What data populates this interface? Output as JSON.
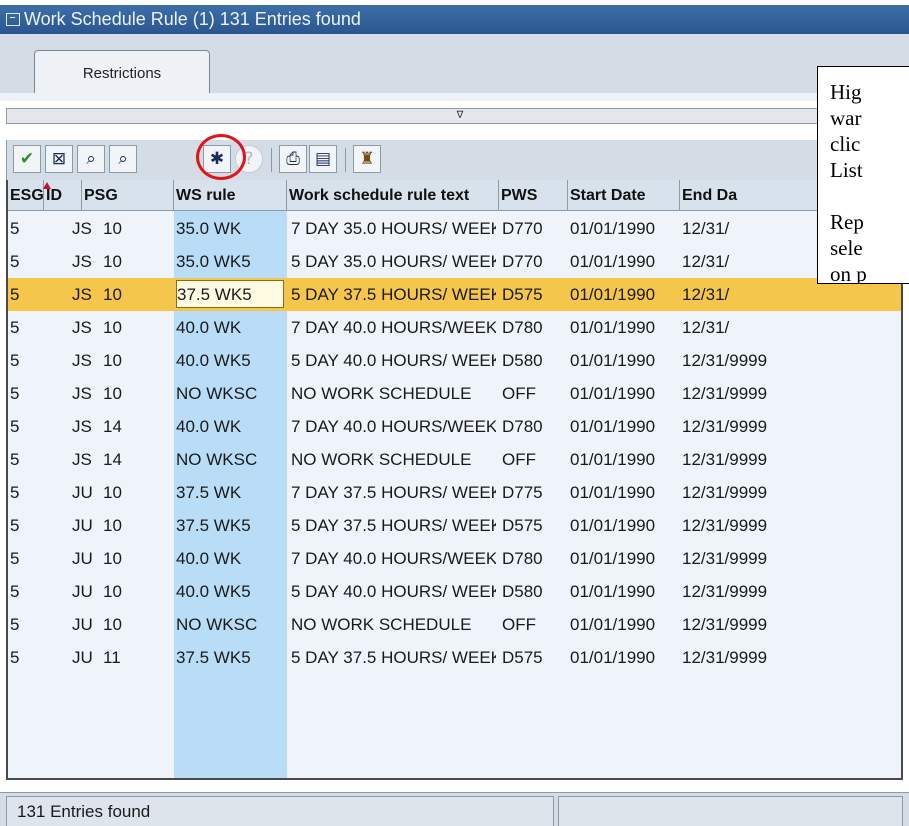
{
  "window": {
    "title": "Work Schedule Rule (1)  131 Entries found"
  },
  "tabs": [
    {
      "label": "Restrictions"
    }
  ],
  "toolbar": {
    "buttons": [
      {
        "icon": "checkmark-icon",
        "glyph": "✔"
      },
      {
        "icon": "cancel-icon",
        "glyph": "⊠"
      },
      {
        "icon": "find-icon",
        "glyph": "⌕"
      },
      {
        "icon": "find-next-icon",
        "glyph": "⌕"
      },
      {
        "icon": "new-entry-icon",
        "glyph": "✱"
      },
      {
        "icon": "help-icon",
        "glyph": "?"
      },
      {
        "icon": "print-icon",
        "glyph": "⎙"
      },
      {
        "icon": "list-icon",
        "glyph": "▤"
      },
      {
        "icon": "settings-icon",
        "glyph": "♜"
      }
    ]
  },
  "table": {
    "columns": [
      "ESG",
      "ID",
      "PSG",
      "WS rule",
      "Work schedule rule text",
      "PWS",
      "Start Date",
      "End Da"
    ],
    "rows": [
      [
        "5",
        "JS",
        "10",
        "35.0 WK",
        "7 DAY 35.0 HOURS/ WEEK",
        "D770",
        "01/01/1990",
        "12/31/"
      ],
      [
        "5",
        "JS",
        "10",
        "35.0 WK5",
        "5 DAY 35.0 HOURS/ WEEK",
        "D770",
        "01/01/1990",
        "12/31/"
      ],
      [
        "5",
        "JS",
        "10",
        "37.5 WK5",
        "5 DAY 37.5 HOURS/ WEEK",
        "D575",
        "01/01/1990",
        "12/31/"
      ],
      [
        "5",
        "JS",
        "10",
        "40.0 WK",
        "7 DAY 40.0 HOURS/WEEK",
        "D780",
        "01/01/1990",
        "12/31/"
      ],
      [
        "5",
        "JS",
        "10",
        "40.0 WK5",
        "5 DAY 40.0 HOURS/ WEEK",
        "D580",
        "01/01/1990",
        "12/31/9999"
      ],
      [
        "5",
        "JS",
        "10",
        "NO WKSC",
        "NO WORK SCHEDULE",
        "OFF",
        "01/01/1990",
        "12/31/9999"
      ],
      [
        "5",
        "JS",
        "14",
        "40.0 WK",
        "7 DAY 40.0 HOURS/WEEK",
        "D780",
        "01/01/1990",
        "12/31/9999"
      ],
      [
        "5",
        "JS",
        "14",
        "NO WKSC",
        "NO WORK SCHEDULE",
        "OFF",
        "01/01/1990",
        "12/31/9999"
      ],
      [
        "5",
        "JU",
        "10",
        "37.5 WK",
        "7 DAY 37.5 HOURS/ WEEK",
        "D775",
        "01/01/1990",
        "12/31/9999"
      ],
      [
        "5",
        "JU",
        "10",
        "37.5 WK5",
        "5 DAY 37.5 HOURS/ WEEK",
        "D575",
        "01/01/1990",
        "12/31/9999"
      ],
      [
        "5",
        "JU",
        "10",
        "40.0 WK",
        "7 DAY 40.0 HOURS/WEEK",
        "D780",
        "01/01/1990",
        "12/31/9999"
      ],
      [
        "5",
        "JU",
        "10",
        "40.0 WK5",
        "5 DAY 40.0 HOURS/ WEEK",
        "D580",
        "01/01/1990",
        "12/31/9999"
      ],
      [
        "5",
        "JU",
        "10",
        "NO WKSC",
        "NO WORK SCHEDULE",
        "OFF",
        "01/01/1990",
        "12/31/9999"
      ],
      [
        "5",
        "JU",
        "11",
        "37.5 WK5",
        "5 DAY 37.5 HOURS/ WEEK",
        "D575",
        "01/01/1990",
        "12/31/9999"
      ]
    ],
    "selected_row": 2
  },
  "status": {
    "text": "131 Entries found"
  },
  "callout": {
    "lines": [
      "Hig",
      "war",
      "clic",
      "List",
      "",
      "Rep",
      "sele",
      "on p"
    ]
  },
  "colors": {
    "selected_row": "#f5c64c",
    "ws_column": "#b9ddf6",
    "highlight_circle": "#e1141a",
    "titlebar": "#2a5690"
  }
}
